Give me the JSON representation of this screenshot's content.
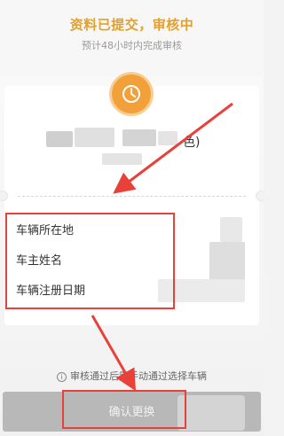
{
  "header": {
    "title": "资料已提交，审核中",
    "subtitle": "预计48小时内完成审核"
  },
  "status_icon": "clock-icon",
  "vehicle": {
    "plate_suffix": "色)"
  },
  "info_labels": [
    "车辆所在地",
    "车主姓名",
    "车辆注册日期"
  ],
  "footer": {
    "tip_icon": "info-icon",
    "tip_text": "审核通过后需手动通过选择车辆",
    "confirm_label": "确认更换"
  },
  "colors": {
    "accent": "#e3a02e",
    "clock": "#f2a13a",
    "annotation": "#e8413a",
    "button_disabled": "#b8b8b8"
  }
}
